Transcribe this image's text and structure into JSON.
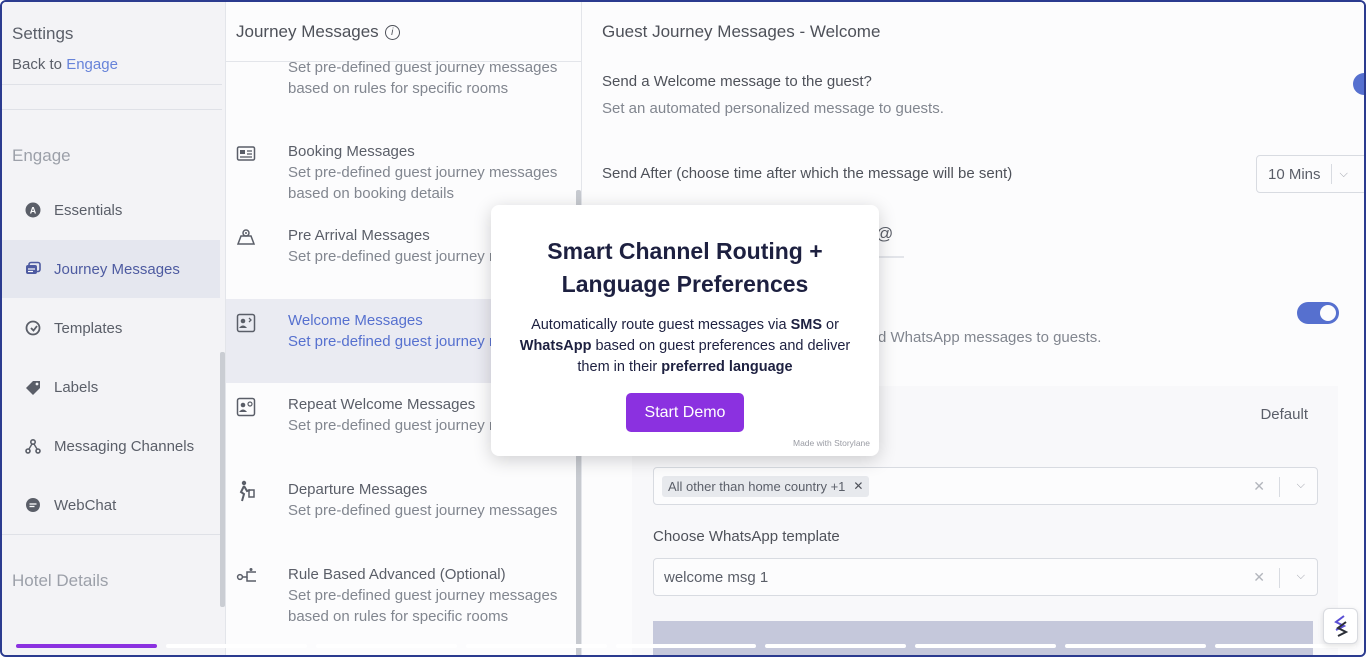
{
  "settings": {
    "title": "Settings",
    "back_prefix": "Back to",
    "back_link": "Engage",
    "group_engage": "Engage",
    "items": [
      {
        "label": "Essentials",
        "icon": "essentials-icon"
      },
      {
        "label": "Journey Messages",
        "icon": "journey-messages-icon"
      },
      {
        "label": "Templates",
        "icon": "templates-icon"
      },
      {
        "label": "Labels",
        "icon": "labels-icon"
      },
      {
        "label": "Messaging Channels",
        "icon": "messaging-channels-icon"
      },
      {
        "label": "WebChat",
        "icon": "webchat-icon"
      }
    ],
    "group_hotel": "Hotel Details"
  },
  "journey": {
    "heading": "Journey Messages",
    "top_desc": "Set pre-defined guest journey messages based on rules for specific rooms",
    "items": [
      {
        "title": "Booking Messages",
        "desc": "Set pre-defined guest journey messages based on booking details"
      },
      {
        "title": "Pre Arrival Messages",
        "desc": "Set pre-defined guest journey messages"
      },
      {
        "title": "Welcome Messages",
        "desc": "Set pre-defined guest journey messages"
      },
      {
        "title": "Repeat Welcome Messages",
        "desc": "Set pre-defined guest journey messages"
      },
      {
        "title": "Departure Messages",
        "desc": "Set pre-defined guest journey messages"
      },
      {
        "title": "Rule Based Advanced (Optional)",
        "desc": "Set pre-defined guest journey messages based on rules for specific rooms"
      }
    ]
  },
  "content": {
    "title": "Guest Journey Messages - Welcome",
    "question": "Send a Welcome message to the guest?",
    "question_desc": "Set an automated personalized message to guests.",
    "send_after": "Send After (choose time after which the message will be sent)",
    "send_after_value": "10 Mins",
    "tab_at": "@",
    "wa_desc": "d WhatsApp messages to guests.",
    "default_label": "Default",
    "country_chip": "All other than home country +1",
    "template_label": "Choose WhatsApp template",
    "template_value": "welcome msg 1"
  },
  "modal": {
    "title_line1": "Smart Channel Routing +",
    "title_line2": "Language Preferences",
    "body_1": "Automatically route guest messages via ",
    "body_sms": "SMS",
    "body_2": " or ",
    "body_wa": "WhatsApp",
    "body_3": " based on guest preferences and deliver them in their ",
    "body_lang": "preferred language",
    "button": "Start Demo",
    "footer": "Made with Storylane"
  },
  "progress": {
    "total_steps": 9,
    "current_step": 1
  },
  "colors": {
    "accent": "#8b31e0",
    "primary": "#3555c7",
    "frame": "#2b3b8f"
  }
}
